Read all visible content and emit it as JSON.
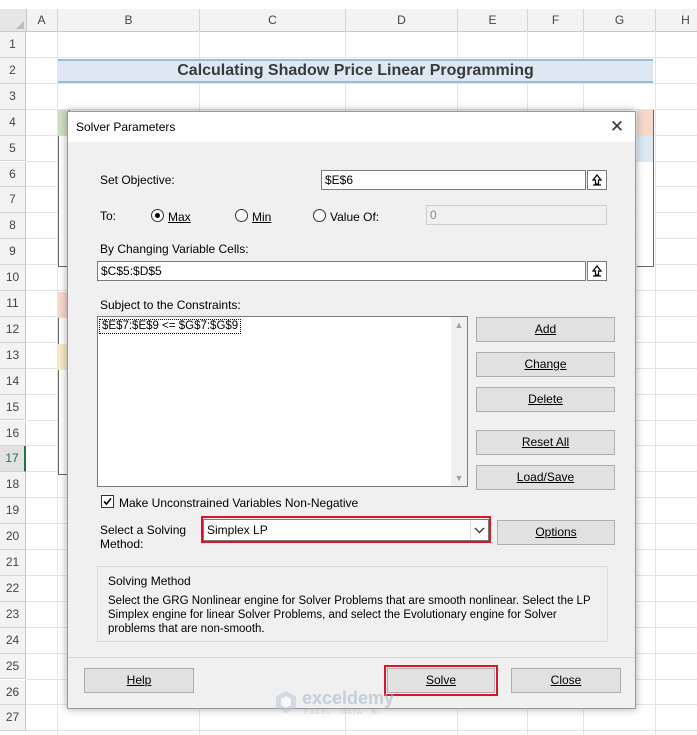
{
  "sheet": {
    "columns": [
      "A",
      "B",
      "C",
      "D",
      "E",
      "F",
      "G",
      "H"
    ],
    "rows": [
      "1",
      "2",
      "3",
      "4",
      "5",
      "6",
      "7",
      "8",
      "9",
      "10",
      "11",
      "12",
      "13",
      "14",
      "15",
      "16",
      "17",
      "18",
      "19",
      "20",
      "21",
      "22",
      "23",
      "24",
      "25",
      "26",
      "27"
    ],
    "selected_row": "17",
    "title": "Calculating Shadow Price Linear Programming"
  },
  "dialog": {
    "title": "Solver Parameters",
    "close_glyph": "✕",
    "set_objective": {
      "label": "Set Objective:",
      "value": "$E$6"
    },
    "to": {
      "label": "To:",
      "options": [
        "Max",
        "Min",
        "Value Of:"
      ],
      "selected": "Max",
      "value_of": "0"
    },
    "changing_cells": {
      "label": "By Changing Variable Cells:",
      "value": "$C$5:$D$5"
    },
    "constraints": {
      "label": "Subject to the Constraints:",
      "items": [
        "$E$7:$E$9 <= $G$7:$G$9"
      ]
    },
    "buttons": {
      "add": "Add",
      "change": "Change",
      "delete": "Delete",
      "reset_all": "Reset All",
      "load_save": "Load/Save",
      "options": "Options",
      "help": "Help",
      "solve": "Solve",
      "close": "Close"
    },
    "non_negative": {
      "label": "Make Unconstrained Variables Non-Negative",
      "checked": true
    },
    "solving_method": {
      "label_line1": "Select a Solving",
      "label_line2": "Method:",
      "value": "Simplex LP"
    },
    "solving_info": {
      "title": "Solving Method",
      "line1": "Select the GRG Nonlinear engine for Solver Problems that are smooth nonlinear. Select the LP",
      "line2": "Simplex engine for linear Solver Problems, and select the Evolutionary engine for Solver",
      "line3": "problems that are non-smooth."
    }
  },
  "watermark": {
    "name": "exceldemy",
    "tagline": "EXCEL · DATA · BI"
  },
  "colors": {
    "highlight": "#d9142b",
    "excel_green": "#217346",
    "title_fill": "#dde8f3"
  }
}
